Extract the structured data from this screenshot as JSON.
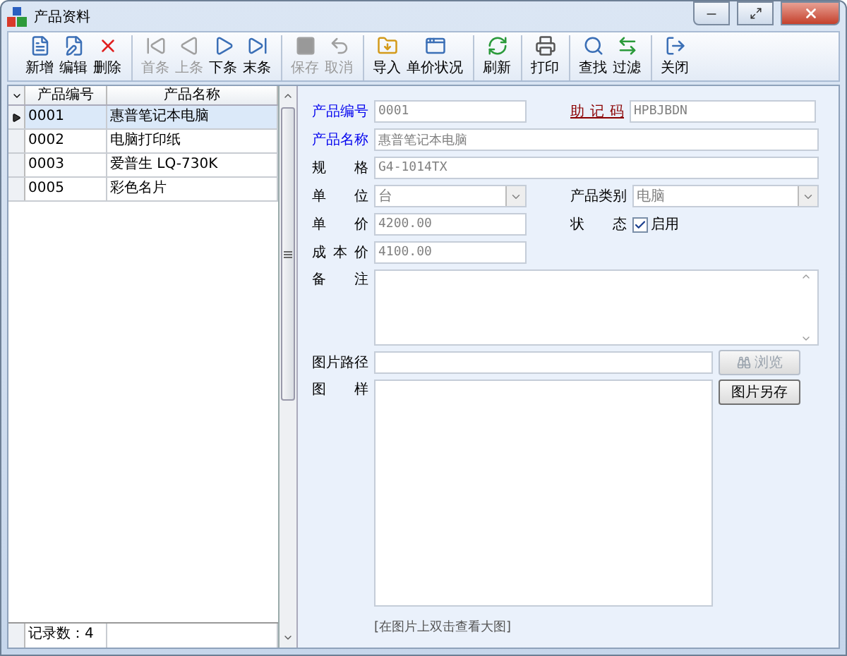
{
  "window": {
    "title": "产品资料"
  },
  "toolbar": [
    {
      "label": "新增",
      "kind": "new",
      "disabled": false,
      "group_start": false
    },
    {
      "label": "编辑",
      "kind": "edit",
      "disabled": false,
      "group_start": false
    },
    {
      "label": "删除",
      "kind": "delete",
      "disabled": false,
      "group_start": false
    },
    {
      "label": "首条",
      "kind": "first",
      "disabled": true,
      "group_start": true
    },
    {
      "label": "上条",
      "kind": "prev",
      "disabled": true,
      "group_start": false
    },
    {
      "label": "下条",
      "kind": "next",
      "disabled": false,
      "group_start": false
    },
    {
      "label": "末条",
      "kind": "last",
      "disabled": false,
      "group_start": false
    },
    {
      "label": "保存",
      "kind": "save",
      "disabled": true,
      "group_start": true
    },
    {
      "label": "取消",
      "kind": "cancel",
      "disabled": true,
      "group_start": false
    },
    {
      "label": "导入",
      "kind": "import",
      "disabled": false,
      "group_start": true
    },
    {
      "label": "单价状况",
      "kind": "price",
      "disabled": false,
      "group_start": false
    },
    {
      "label": "刷新",
      "kind": "refresh",
      "disabled": false,
      "group_start": true
    },
    {
      "label": "打印",
      "kind": "print",
      "disabled": false,
      "group_start": true
    },
    {
      "label": "查找",
      "kind": "find",
      "disabled": false,
      "group_start": true
    },
    {
      "label": "过滤",
      "kind": "filter",
      "disabled": false,
      "group_start": false
    },
    {
      "label": "关闭",
      "kind": "close",
      "disabled": false,
      "group_start": true
    }
  ],
  "grid": {
    "columns": [
      "产品编号",
      "产品名称"
    ],
    "rows": [
      {
        "cells": [
          "0001",
          "惠普笔记本电脑"
        ],
        "selected": true
      },
      {
        "cells": [
          "0002",
          "电脑打印纸"
        ],
        "selected": false
      },
      {
        "cells": [
          "0003",
          "爱普生 LQ-730K"
        ],
        "selected": false
      },
      {
        "cells": [
          "0005",
          "彩色名片"
        ],
        "selected": false
      }
    ],
    "footer": "记录数：4"
  },
  "form": {
    "lines": [
      [
        {
          "label": "产品编号",
          "required": true,
          "link": false,
          "kind": "text",
          "value": "0001"
        },
        {
          "label": "助记码",
          "required": false,
          "link": true,
          "kind": "text",
          "value": "HPBJBDN"
        }
      ],
      [
        {
          "label": "产品名称",
          "required": true,
          "link": false,
          "kind": "wide",
          "value": "惠普笔记本电脑"
        }
      ],
      [
        {
          "label": "规格",
          "required": false,
          "link": false,
          "kind": "wide",
          "value": "G4-1014TX"
        }
      ],
      [
        {
          "label": "单位",
          "required": false,
          "link": false,
          "kind": "select",
          "value": "台"
        },
        {
          "label": "产品类别",
          "required": false,
          "link": false,
          "kind": "select",
          "value": "电脑"
        }
      ],
      [
        {
          "label": "单价",
          "required": false,
          "link": false,
          "kind": "text",
          "value": "4200.00"
        },
        {
          "label": "状态",
          "required": false,
          "link": false,
          "kind": "checkbox",
          "value": "启用",
          "checked": true
        }
      ],
      [
        {
          "label": "成本价",
          "required": false,
          "link": false,
          "kind": "text",
          "value": "4100.00"
        }
      ]
    ],
    "remarks": {
      "label": "备注"
    },
    "path": {
      "label": "图片路径",
      "button": "浏览",
      "button_disabled": true
    },
    "image": {
      "label": "图样",
      "button": "图片另存",
      "caption": "[在图片上双击查看大图]"
    }
  }
}
